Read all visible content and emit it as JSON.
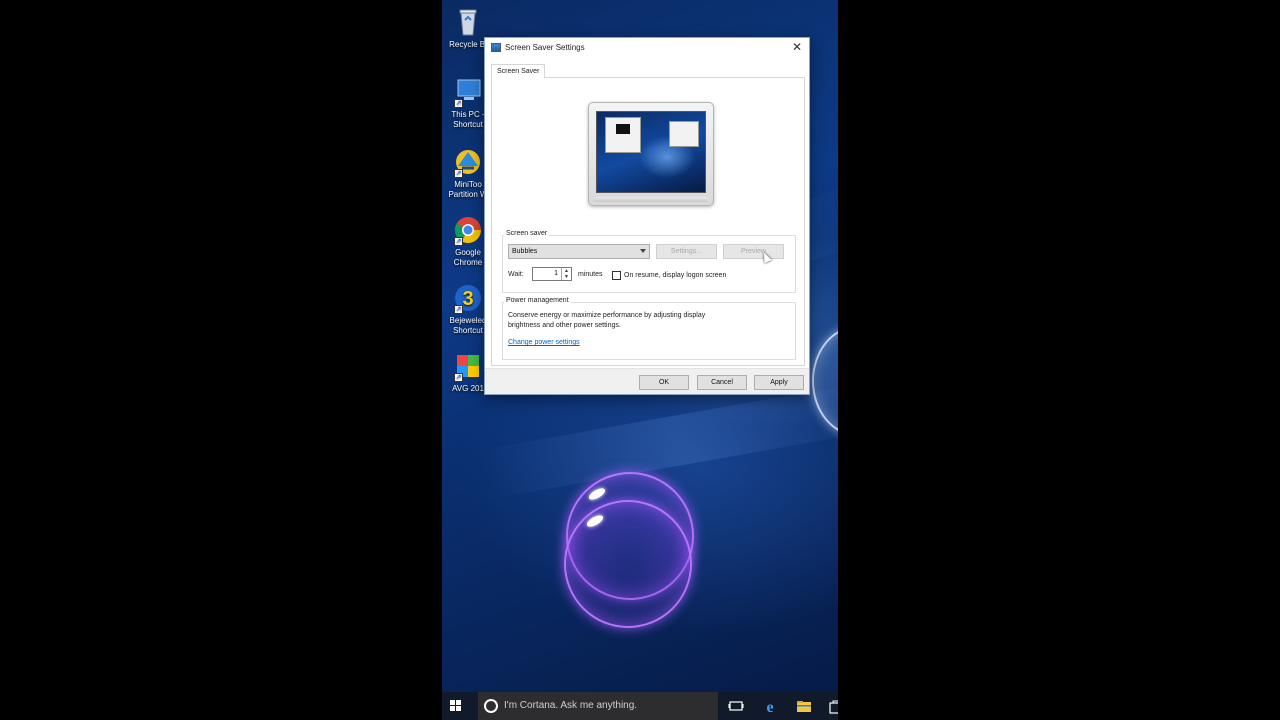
{
  "desktop": {
    "icons": [
      {
        "label": "Recycle Bi",
        "icon": "recycle-bin-icon"
      },
      {
        "label": "This PC - Shortcut",
        "icon": "computer-icon"
      },
      {
        "label": "MiniToo Partition W",
        "icon": "minitool-icon"
      },
      {
        "label": "Google Chrome",
        "icon": "chrome-icon"
      },
      {
        "label": "Bejeweled Shortcut",
        "icon": "bejeweled-icon"
      },
      {
        "label": "AVG 201",
        "icon": "avg-icon"
      }
    ]
  },
  "dialog": {
    "title": "Screen Saver Settings",
    "close_glyph": "✕",
    "tab_label": "Screen Saver",
    "screen_saver_group": {
      "title": "Screen saver",
      "selected": "Bubbles",
      "settings_label": "Settings...",
      "preview_label": "Preview",
      "wait_label": "Wait:",
      "wait_value": "1",
      "minutes_label": "minutes",
      "resume_label": "On resume, display logon screen",
      "resume_checked": false
    },
    "power_group": {
      "title": "Power management",
      "description_line1": "Conserve energy or maximize performance by adjusting display",
      "description_line2": "brightness and other power settings.",
      "link_label": "Change power settings"
    },
    "buttons": {
      "ok": "OK",
      "cancel": "Cancel",
      "apply": "Apply"
    }
  },
  "taskbar": {
    "cortana_placeholder": "I'm Cortana. Ask me anything.",
    "icons": [
      "windows-start-icon",
      "task-view-icon",
      "edge-icon",
      "file-explorer-icon",
      "store-icon"
    ]
  },
  "colors": {
    "desktop_blue": "#0d3a86",
    "bubble_purple": "#be78ff",
    "link_blue": "#0066cc",
    "taskbar": "#101a2b"
  }
}
